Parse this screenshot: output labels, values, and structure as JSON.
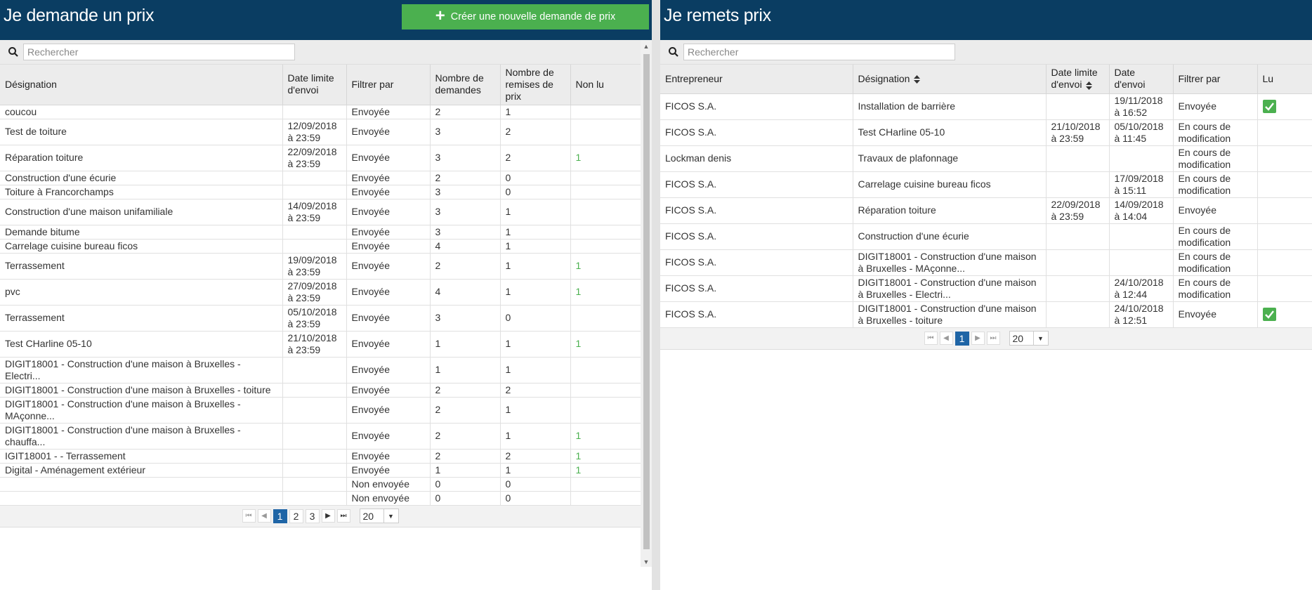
{
  "left": {
    "title": "Je demande un prix",
    "new_button_label": "Créer une nouvelle demande de prix",
    "search_placeholder": "Rechercher",
    "columns": {
      "designation": "Désignation",
      "date": "Date limite d'envoi",
      "filter": "Filtrer par",
      "demandes": "Nombre de demandes",
      "remises": "Nombre de remises de prix",
      "nonlu": "Non lu"
    },
    "rows": [
      {
        "designation": "coucou",
        "date": "",
        "filter": "Envoyée",
        "demandes": "2",
        "remises": "1",
        "nonlu": ""
      },
      {
        "designation": "Test de toiture",
        "date": "12/09/2018 à 23:59",
        "filter": "Envoyée",
        "demandes": "3",
        "remises": "2",
        "nonlu": ""
      },
      {
        "designation": "Réparation toiture",
        "date": "22/09/2018 à 23:59",
        "filter": "Envoyée",
        "demandes": "3",
        "remises": "2",
        "nonlu": "1"
      },
      {
        "designation": "Construction d'une écurie",
        "date": "",
        "filter": "Envoyée",
        "demandes": "2",
        "remises": "0",
        "nonlu": ""
      },
      {
        "designation": "Toiture à Francorchamps",
        "date": "",
        "filter": "Envoyée",
        "demandes": "3",
        "remises": "0",
        "nonlu": ""
      },
      {
        "designation": "Construction d'une maison unifamiliale",
        "date": "14/09/2018 à 23:59",
        "filter": "Envoyée",
        "demandes": "3",
        "remises": "1",
        "nonlu": ""
      },
      {
        "designation": "Demande bitume",
        "date": "",
        "filter": "Envoyée",
        "demandes": "3",
        "remises": "1",
        "nonlu": ""
      },
      {
        "designation": "Carrelage cuisine bureau ficos",
        "date": "",
        "filter": "Envoyée",
        "demandes": "4",
        "remises": "1",
        "nonlu": ""
      },
      {
        "designation": "Terrassement",
        "date": "19/09/2018 à 23:59",
        "filter": "Envoyée",
        "demandes": "2",
        "remises": "1",
        "nonlu": "1"
      },
      {
        "designation": "pvc",
        "date": "27/09/2018 à 23:59",
        "filter": "Envoyée",
        "demandes": "4",
        "remises": "1",
        "nonlu": "1"
      },
      {
        "designation": "Terrassement",
        "date": "05/10/2018 à 23:59",
        "filter": "Envoyée",
        "demandes": "3",
        "remises": "0",
        "nonlu": ""
      },
      {
        "designation": "Test CHarline 05-10",
        "date": "21/10/2018 à 23:59",
        "filter": "Envoyée",
        "demandes": "1",
        "remises": "1",
        "nonlu": "1"
      },
      {
        "designation": "DIGIT18001 - Construction d'une maison à Bruxelles - Electri...",
        "date": "",
        "filter": "Envoyée",
        "demandes": "1",
        "remises": "1",
        "nonlu": ""
      },
      {
        "designation": "DIGIT18001 - Construction d'une maison à Bruxelles - toiture",
        "date": "",
        "filter": "Envoyée",
        "demandes": "2",
        "remises": "2",
        "nonlu": ""
      },
      {
        "designation": "DIGIT18001 - Construction d'une maison à Bruxelles - MAçonne...",
        "date": "",
        "filter": "Envoyée",
        "demandes": "2",
        "remises": "1",
        "nonlu": ""
      },
      {
        "designation": "DIGIT18001 - Construction d'une maison à Bruxelles - chauffa...",
        "date": "",
        "filter": "Envoyée",
        "demandes": "2",
        "remises": "1",
        "nonlu": "1"
      },
      {
        "designation": "IGIT18001 - - Terrassement",
        "date": "",
        "filter": "Envoyée",
        "demandes": "2",
        "remises": "2",
        "nonlu": "1"
      },
      {
        "designation": "Digital - Aménagement extérieur",
        "date": "",
        "filter": "Envoyée",
        "demandes": "1",
        "remises": "1",
        "nonlu": "1"
      },
      {
        "designation": "",
        "date": "",
        "filter": "Non envoyée",
        "demandes": "0",
        "remises": "0",
        "nonlu": ""
      },
      {
        "designation": "",
        "date": "",
        "filter": "Non envoyée",
        "demandes": "0",
        "remises": "0",
        "nonlu": ""
      }
    ],
    "pager": {
      "pages": [
        "1",
        "2",
        "3"
      ],
      "current": "1",
      "page_size": "20"
    }
  },
  "right": {
    "title": "Je remets prix",
    "search_placeholder": "Rechercher",
    "columns": {
      "entrepreneur": "Entrepreneur",
      "designation": "Désignation",
      "date_limite": "Date limite d'envoi",
      "date_envoi": "Date d'envoi",
      "filter": "Filtrer par",
      "lu": "Lu"
    },
    "rows": [
      {
        "entrepreneur": "FICOS S.A.",
        "designation": "Installation de barrière",
        "date_limite": "",
        "date_envoi": "19/11/2018 à 16:52",
        "filter": "Envoyée",
        "lu": true
      },
      {
        "entrepreneur": "FICOS S.A.",
        "designation": "Test CHarline 05-10",
        "date_limite": "21/10/2018 à 23:59",
        "date_envoi": "05/10/2018 à 11:45",
        "filter": "En cours de modification",
        "lu": false
      },
      {
        "entrepreneur": "Lockman denis",
        "designation": "Travaux de plafonnage",
        "date_limite": "",
        "date_envoi": "",
        "filter": "En cours de modification",
        "lu": false
      },
      {
        "entrepreneur": "FICOS S.A.",
        "designation": "Carrelage cuisine bureau ficos",
        "date_limite": "",
        "date_envoi": "17/09/2018 à 15:11",
        "filter": "En cours de modification",
        "lu": false
      },
      {
        "entrepreneur": "FICOS S.A.",
        "designation": "Réparation toiture",
        "date_limite": "22/09/2018 à 23:59",
        "date_envoi": "14/09/2018 à 14:04",
        "filter": "Envoyée",
        "lu": false
      },
      {
        "entrepreneur": "FICOS S.A.",
        "designation": "Construction d'une écurie",
        "date_limite": "",
        "date_envoi": "",
        "filter": "En cours de modification",
        "lu": false
      },
      {
        "entrepreneur": "FICOS S.A.",
        "designation": "DIGIT18001 - Construction d'une maison à Bruxelles - MAçonne...",
        "date_limite": "",
        "date_envoi": "",
        "filter": "En cours de modification",
        "lu": false
      },
      {
        "entrepreneur": "FICOS S.A.",
        "designation": "DIGIT18001 - Construction d'une maison à Bruxelles - Electri...",
        "date_limite": "",
        "date_envoi": "24/10/2018 à 12:44",
        "filter": "En cours de modification",
        "lu": false
      },
      {
        "entrepreneur": "FICOS S.A.",
        "designation": "DIGIT18001 - Construction d'une maison à Bruxelles - toiture",
        "date_limite": "",
        "date_envoi": "24/10/2018 à 12:51",
        "filter": "Envoyée",
        "lu": true
      }
    ],
    "pager": {
      "pages": [
        "1"
      ],
      "current": "1",
      "page_size": "20"
    }
  },
  "colors": {
    "header": "#0a3d62",
    "accent": "#4bb04f",
    "page_active": "#1f65a6"
  }
}
